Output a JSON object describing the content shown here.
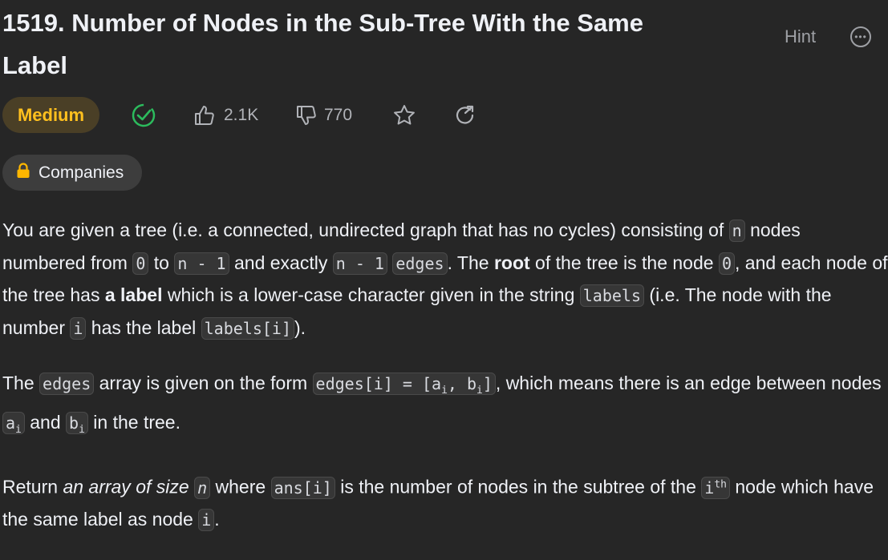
{
  "problem": {
    "title": "1519. Number of Nodes in the Sub-Tree With the Same Label",
    "difficulty": "Medium",
    "likes": "2.1K",
    "dislikes": "770",
    "hint_label": "Hint",
    "companies_label": "Companies"
  },
  "colors": {
    "background": "#262626",
    "difficulty_medium": "#ffc01e",
    "solved_check": "#2cbb5d",
    "lock": "#ffb700"
  },
  "description": {
    "p1": {
      "t1": "You are given a tree (i.e. a connected, undirected graph that has no cycles) consisting of ",
      "c1": "n",
      "t2": " nodes numbered from ",
      "c2": "0",
      "t3": " to ",
      "c3": "n - 1",
      "t4": " and exactly ",
      "c4": "n - 1",
      "t5": " ",
      "c5": "edges",
      "t6": ". The ",
      "b1": "root",
      "t7": " of the tree is the node ",
      "c6": "0",
      "t8": ", and each node of the tree has ",
      "b2": "a label",
      "t9": " which is a lower-case character given in the string ",
      "c7": "labels",
      "t10": " (i.e. The node with the number ",
      "c8": "i",
      "t11": " has the label ",
      "c9": "labels[i]",
      "t12": ")."
    },
    "p2": {
      "t1": "The ",
      "c1": "edges",
      "t2": " array is given on the form ",
      "c2a": "edges[i] = [a",
      "c2sub1": "i",
      "c2b": ", b",
      "c2sub2": "i",
      "c2c": "]",
      "t3": ", which means there is an edge between nodes ",
      "c3": "a",
      "c3sub": "i",
      "t4": " and ",
      "c4": "b",
      "c4sub": "i",
      "t5": " in the tree."
    },
    "p3": {
      "t1": "Return ",
      "i1": "an array of size",
      "t2": " ",
      "c1": "n",
      "t3": " where ",
      "c2": "ans[i]",
      "t4": " is the number of nodes in the subtree of the ",
      "c3": "i",
      "c3sup": "th",
      "t5": " node which have the same label as node ",
      "c4": "i",
      "t6": "."
    }
  }
}
